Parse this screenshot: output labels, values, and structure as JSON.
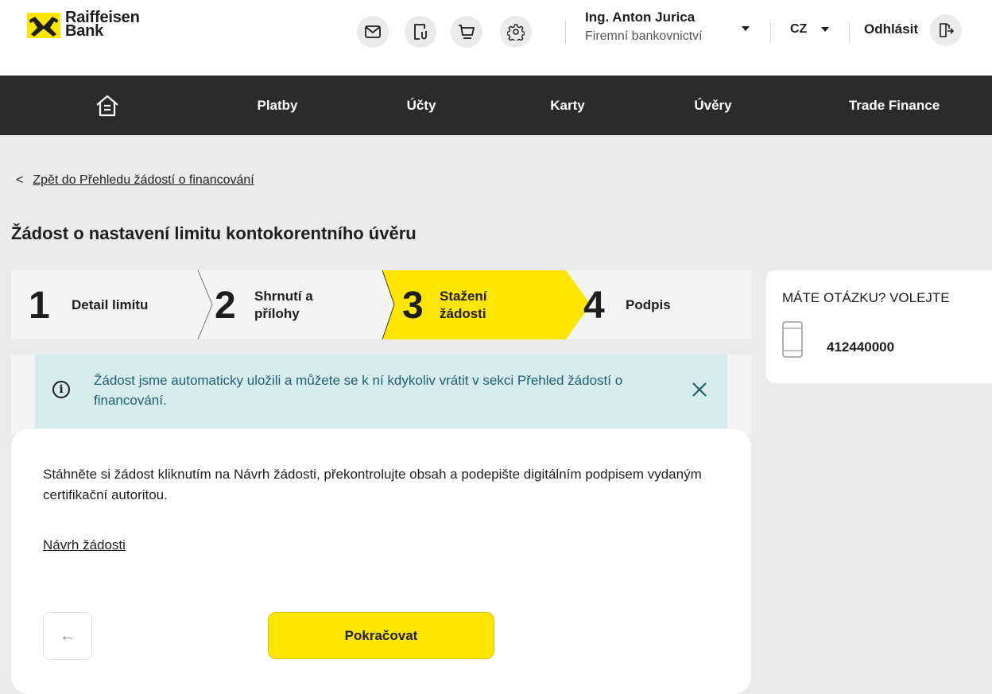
{
  "header": {
    "logo_line1": "Raiffeisen",
    "logo_line2": "Bank",
    "icons": [
      "mail-icon",
      "document-icon",
      "cart-icon",
      "gear-icon"
    ],
    "user_name": "Ing. Anton Jurica",
    "user_role": "Firemní bankovnictví",
    "language": "CZ",
    "logout_label": "Odhlásit"
  },
  "nav": {
    "home_icon": "home-icon",
    "items": [
      "Platby",
      "Účty",
      "Karty",
      "Úvěry",
      "Trade Finance"
    ]
  },
  "back_link": "Zpět do Přehledu žádostí o financování",
  "page_title": "Žádost o nastavení limitu kontokorentního úvěru",
  "stepper": {
    "steps": [
      {
        "num": "1",
        "line1": "Detail limitu",
        "line2": ""
      },
      {
        "num": "2",
        "line1": "Shrnutí a",
        "line2": "přílohy"
      },
      {
        "num": "3",
        "line1": "Stažení",
        "line2": "žádosti"
      },
      {
        "num": "4",
        "line1": "Podpis",
        "line2": ""
      }
    ],
    "active_step": 3
  },
  "info": {
    "text": "Žádost jsme automaticky uložili a můžete se k ní kdykoliv vrátit v sekci  Přehled žádostí o financování."
  },
  "main": {
    "description": "Stáhněte si žádost kliknutím na Návrh žádosti, překontrolujte obsah a podepište digitálním podpisem vydaným certifikační autoritou.",
    "draft_link": "Návrh žádosti",
    "back_button_arrow": "←",
    "continue_label": "Pokračovat"
  },
  "sidebar": {
    "title": "MÁTE OTÁZKU? VOLEJTE",
    "phone": "412440000"
  },
  "colors": {
    "brand_yellow": "#fee600",
    "nav_dark": "#2b2b2b",
    "info_bg": "#d7ecef",
    "info_text": "#1f5e6d",
    "page_bg": "#ebebeb"
  }
}
